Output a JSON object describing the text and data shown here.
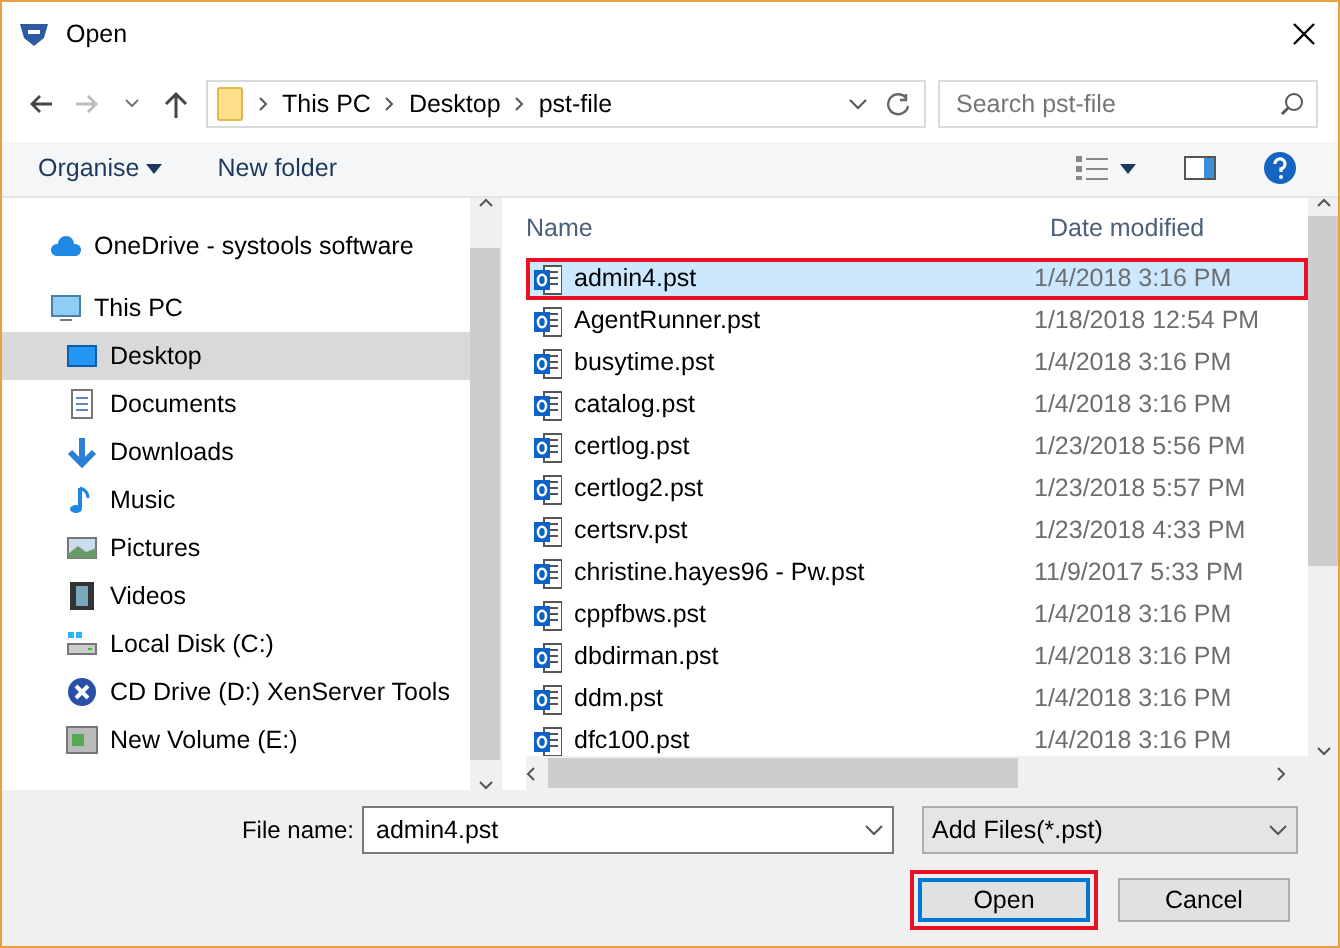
{
  "window": {
    "title": "Open"
  },
  "address": {
    "path": [
      "This PC",
      "Desktop",
      "pst-file"
    ]
  },
  "search": {
    "placeholder": "Search pst-file"
  },
  "toolbar": {
    "organise": "Organise",
    "new_folder": "New folder"
  },
  "sidebar": {
    "items": [
      {
        "label": "OneDrive - systools software",
        "kind": "cloud",
        "selected": false
      },
      {
        "label": "This PC",
        "kind": "pc",
        "selected": false,
        "children": [
          {
            "label": "Desktop",
            "kind": "desktop",
            "selected": true
          },
          {
            "label": "Documents",
            "kind": "documents",
            "selected": false
          },
          {
            "label": "Downloads",
            "kind": "downloads",
            "selected": false
          },
          {
            "label": "Music",
            "kind": "music",
            "selected": false
          },
          {
            "label": "Pictures",
            "kind": "pictures",
            "selected": false
          },
          {
            "label": "Videos",
            "kind": "videos",
            "selected": false
          },
          {
            "label": "Local Disk (C:)",
            "kind": "disk",
            "selected": false
          },
          {
            "label": "CD Drive (D:) XenServer Tools",
            "kind": "cd",
            "selected": false
          },
          {
            "label": "New Volume (E:)",
            "kind": "volume",
            "selected": false
          }
        ]
      }
    ]
  },
  "table": {
    "columns": [
      "Name",
      "Date modified"
    ],
    "rows": [
      {
        "name": "admin4.pst",
        "date": "1/4/2018 3:16 PM",
        "selected": true,
        "highlighted": true
      },
      {
        "name": "AgentRunner.pst",
        "date": "1/18/2018 12:54 PM",
        "selected": false,
        "highlighted": false
      },
      {
        "name": "busytime.pst",
        "date": "1/4/2018 3:16 PM",
        "selected": false,
        "highlighted": false
      },
      {
        "name": "catalog.pst",
        "date": "1/4/2018 3:16 PM",
        "selected": false,
        "highlighted": false
      },
      {
        "name": "certlog.pst",
        "date": "1/23/2018 5:56 PM",
        "selected": false,
        "highlighted": false
      },
      {
        "name": "certlog2.pst",
        "date": "1/23/2018 5:57 PM",
        "selected": false,
        "highlighted": false
      },
      {
        "name": "certsrv.pst",
        "date": "1/23/2018 4:33 PM",
        "selected": false,
        "highlighted": false
      },
      {
        "name": "christine.hayes96 - Pw.pst",
        "date": "11/9/2017 5:33 PM",
        "selected": false,
        "highlighted": false
      },
      {
        "name": "cppfbws.pst",
        "date": "1/4/2018 3:16 PM",
        "selected": false,
        "highlighted": false
      },
      {
        "name": "dbdirman.pst",
        "date": "1/4/2018 3:16 PM",
        "selected": false,
        "highlighted": false
      },
      {
        "name": "ddm.pst",
        "date": "1/4/2018 3:16 PM",
        "selected": false,
        "highlighted": false
      },
      {
        "name": "dfc100.pst",
        "date": "1/4/2018 3:16 PM",
        "selected": false,
        "highlighted": false
      }
    ]
  },
  "footer": {
    "file_name_label": "File name:",
    "file_name": "admin4.pst",
    "filter": "Add Files(*.pst)",
    "buttons": [
      {
        "label": "Open",
        "highlighted": true,
        "default": true
      },
      {
        "label": "Cancel",
        "highlighted": false,
        "default": false
      }
    ]
  }
}
